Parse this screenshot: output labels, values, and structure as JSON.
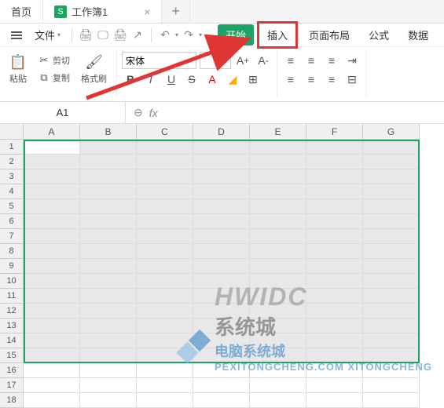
{
  "tabs": {
    "home": "首页",
    "doc": "工作簿1",
    "doc_icon": "S"
  },
  "menu": {
    "file": "文件",
    "ribbon_tabs": {
      "start": "开始",
      "insert": "插入",
      "layout": "页面布局",
      "formula": "公式",
      "data": "数据"
    }
  },
  "ribbon": {
    "paste": "粘贴",
    "cut": "剪切",
    "copy": "复制",
    "format_painter": "格式刷",
    "font_name": "宋体",
    "font_size": ""
  },
  "refbar": {
    "name": "A1",
    "fx": "fx"
  },
  "grid": {
    "cols": [
      "A",
      "B",
      "C",
      "D",
      "E",
      "F",
      "G"
    ],
    "rows": [
      "1",
      "2",
      "3",
      "4",
      "5",
      "6",
      "7",
      "8",
      "9",
      "10",
      "11",
      "12",
      "13",
      "14",
      "15",
      "16",
      "17",
      "18"
    ]
  },
  "watermark": {
    "en": "HWIDC",
    "cn": "系统城",
    "sub": "电脑系统城",
    "url": "PEXITONGCHENG.COM  XITONGCHENG"
  }
}
